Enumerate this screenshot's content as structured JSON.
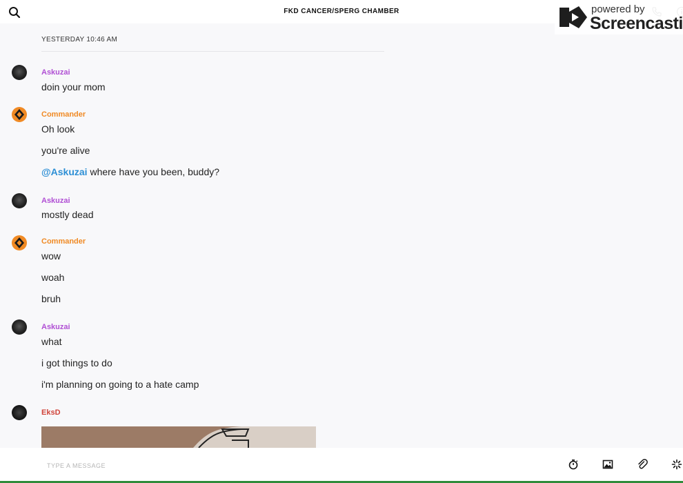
{
  "header": {
    "title": "FKD CANCER/SPERG CHAMBER",
    "search_icon": "search-icon",
    "phone_icon": "phone-icon",
    "info_icon": "info-icon"
  },
  "watermark": {
    "powered": "powered by",
    "brand": "Screencastify"
  },
  "date_separator": "YESTERDAY 10:46 AM",
  "messages": {
    "g1": {
      "user": "Askuzai",
      "lines": [
        "doin your mom"
      ]
    },
    "g2": {
      "user": "Commander",
      "lines": [
        "Oh look",
        "you're alive",
        "where have you been, buddy?"
      ],
      "mention": "@Askuzai"
    },
    "g3": {
      "user": "Askuzai",
      "lines": [
        "mostly dead"
      ]
    },
    "g4": {
      "user": "Commander",
      "lines": [
        "wow",
        "woah",
        "bruh"
      ]
    },
    "g5": {
      "user": "Askuzai",
      "lines": [
        "what",
        "i got things to do",
        "i'm planning on going to a hate camp"
      ]
    },
    "g6": {
      "user": "EksD"
    }
  },
  "composer": {
    "placeholder": "TYPE A MESSAGE",
    "icons": [
      "timer-icon",
      "image-icon",
      "paperclip-icon",
      "sparkle-icon"
    ]
  },
  "colors": {
    "askuzai": "#b04fd4",
    "commander": "#f08a24",
    "eksd": "#d0443a",
    "mention": "#2d8fd5"
  }
}
